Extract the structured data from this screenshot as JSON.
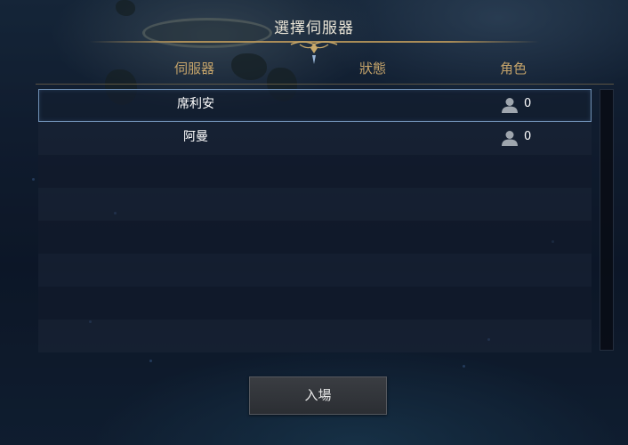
{
  "dialog": {
    "title": "選擇伺服器"
  },
  "columns": {
    "server": "伺服器",
    "status": "狀態",
    "characters": "角色"
  },
  "servers": [
    {
      "name": "席利安",
      "status": "",
      "characters": "0",
      "selected": true
    },
    {
      "name": "阿曼",
      "status": "",
      "characters": "0",
      "selected": false
    }
  ],
  "empty_row_count": 6,
  "actions": {
    "enter_label": "入場"
  },
  "icons": {
    "character": "user-icon",
    "ornament": "title-ornament-icon"
  },
  "colors": {
    "header_gold": "#c4a36a",
    "title_text": "#e9e4d6",
    "selection_border": "#6e8fb4"
  }
}
